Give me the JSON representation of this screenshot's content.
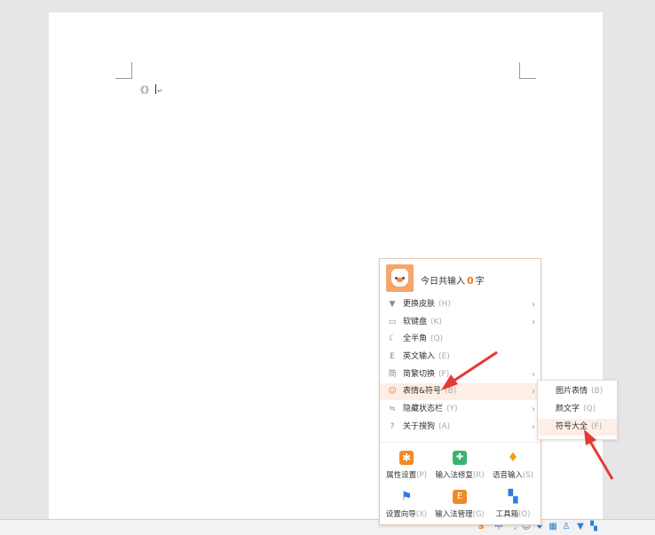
{
  "document": {
    "text": "《》",
    "para_mark": "↵"
  },
  "menu": {
    "header_prefix": "今日共输入",
    "count": "0",
    "header_suffix": "字",
    "items": [
      {
        "label": "更换皮肤",
        "key": "(H)",
        "icon": "tshirt-icon",
        "arrow": true
      },
      {
        "label": "软键盘",
        "key": "(K)",
        "icon": "keyboard-icon",
        "arrow": true
      },
      {
        "label": "全半角",
        "key": "(Q)",
        "icon": "moon-icon",
        "arrow": false
      },
      {
        "label": "英文输入",
        "key": "(E)",
        "icon": "english-icon",
        "arrow": false
      },
      {
        "label": "简繁切换",
        "key": "(F)",
        "icon": "jian-icon",
        "arrow": true
      },
      {
        "label": "表情&符号",
        "key": "(B)",
        "icon": "smiley-icon",
        "arrow": true
      },
      {
        "label": "隐藏状态栏",
        "key": "(Y)",
        "icon": "hide-icon",
        "arrow": true
      },
      {
        "label": "关于搜狗",
        "key": "(A)",
        "icon": "question-icon",
        "arrow": true
      }
    ],
    "tools": [
      {
        "label": "属性设置",
        "key": "(P)",
        "icon": "gear-icon",
        "color": "#f08a24"
      },
      {
        "label": "输入法修复",
        "key": "(R)",
        "icon": "repair-icon",
        "color": "#3cb371"
      },
      {
        "label": "语音输入",
        "key": "(S)",
        "icon": "mic-icon",
        "color": "#f0a020"
      },
      {
        "label": "设置向导",
        "key": "(X)",
        "icon": "flag-icon",
        "color": "#2a7de1"
      },
      {
        "label": "输入法管理",
        "key": "(G)",
        "icon": "manage-icon",
        "color": "#f08a24"
      },
      {
        "label": "工具箱",
        "key": "(O)",
        "icon": "toolbox-icon",
        "color": "#2a7de1"
      }
    ]
  },
  "submenu": {
    "items": [
      {
        "label": "图片表情",
        "key": "(B)"
      },
      {
        "label": "颜文字",
        "key": "(Q)"
      },
      {
        "label": "符号大全",
        "key": "(F)"
      }
    ]
  },
  "taskbar": {
    "ime_mode": "中"
  }
}
